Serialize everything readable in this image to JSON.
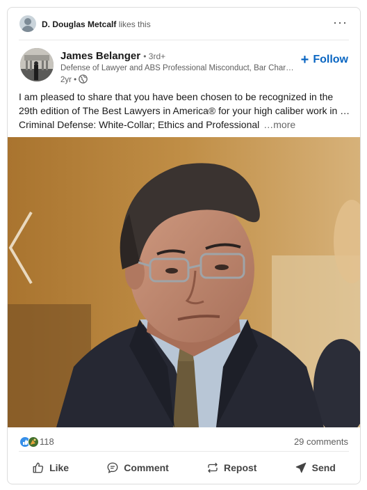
{
  "social_context": {
    "actor": "D. Douglas Metcalf",
    "action": "likes this",
    "more_icon": "more-horizontal-icon"
  },
  "author": {
    "name": "James Belanger",
    "degree": "• 3rd+",
    "headline": "Defense of Lawyer and ABS Professional Misconduct, Bar Charges…",
    "time": "2yr •",
    "visibility_icon": "globe-icon"
  },
  "follow_label": "Follow",
  "commentary": {
    "line1": "I am pleased to share that you have been chosen to be recognized in the",
    "line2": "29th edition of The Best Lawyers in America® for your high caliber work in …",
    "line3": "Criminal Defense: White-Collar; Ethics and Professional",
    "see_more": "…more"
  },
  "social_counts": {
    "reactions": "118",
    "reaction_icons": [
      "like-icon",
      "celebrate-icon"
    ],
    "comments": "29 comments"
  },
  "actions": {
    "like": "Like",
    "comment": "Comment",
    "repost": "Repost",
    "send": "Send"
  },
  "colors": {
    "accent": "#0a66c2",
    "card_border": "#dcdcdc",
    "muted_text": "#5e5e5e"
  }
}
